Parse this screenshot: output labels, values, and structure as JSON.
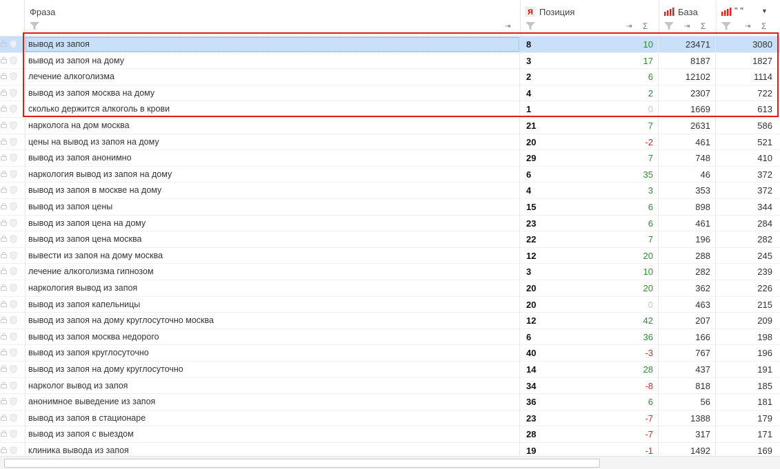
{
  "columns": {
    "phrase": "Фраза",
    "position": "Позиция",
    "base": "База",
    "quote": "\" \""
  },
  "colors": {
    "highlight": "#e31a1a",
    "selected_row": "#c8e0fa",
    "positive": "#2e8b2e",
    "negative": "#d8261e",
    "zero": "#c8c8c8"
  },
  "icons": [
    "lock-icon",
    "shield-icon",
    "filter-icon",
    "pin-icon",
    "sigma-icon",
    "yandex-icon",
    "bar-chart-icon",
    "dropdown-arrow-icon"
  ],
  "rows": [
    {
      "phrase": "вывод из запоя",
      "position": "8",
      "delta": "10",
      "base": "23471",
      "quote": "3080"
    },
    {
      "phrase": "вывод из запоя на дому",
      "position": "3",
      "delta": "17",
      "base": "8187",
      "quote": "1827"
    },
    {
      "phrase": "лечение алкоголизма",
      "position": "2",
      "delta": "6",
      "base": "12102",
      "quote": "1114"
    },
    {
      "phrase": "вывод из запоя москва на дому",
      "position": "4",
      "delta": "2",
      "base": "2307",
      "quote": "722"
    },
    {
      "phrase": "сколько держится алкоголь в крови",
      "position": "1",
      "delta": "0",
      "base": "1669",
      "quote": "613"
    },
    {
      "phrase": "нарколога на дом москва",
      "position": "21",
      "delta": "7",
      "base": "2631",
      "quote": "586"
    },
    {
      "phrase": "цены на вывод из запоя на дому",
      "position": "20",
      "delta": "-2",
      "base": "461",
      "quote": "521"
    },
    {
      "phrase": "вывод из запоя анонимно",
      "position": "29",
      "delta": "7",
      "base": "748",
      "quote": "410"
    },
    {
      "phrase": "наркология вывод из запоя на дому",
      "position": "6",
      "delta": "35",
      "base": "46",
      "quote": "372"
    },
    {
      "phrase": "вывод из запоя в москве на дому",
      "position": "4",
      "delta": "3",
      "base": "353",
      "quote": "372"
    },
    {
      "phrase": "вывод из запоя цены",
      "position": "15",
      "delta": "6",
      "base": "898",
      "quote": "344"
    },
    {
      "phrase": "вывод из запоя цена на дому",
      "position": "23",
      "delta": "6",
      "base": "461",
      "quote": "284"
    },
    {
      "phrase": "вывод из запоя цена москва",
      "position": "22",
      "delta": "7",
      "base": "196",
      "quote": "282"
    },
    {
      "phrase": "вывести из запоя на дому москва",
      "position": "12",
      "delta": "20",
      "base": "288",
      "quote": "245"
    },
    {
      "phrase": "лечение алкоголизма гипнозом",
      "position": "3",
      "delta": "10",
      "base": "282",
      "quote": "239"
    },
    {
      "phrase": "наркология вывод из запоя",
      "position": "20",
      "delta": "20",
      "base": "362",
      "quote": "226"
    },
    {
      "phrase": "вывод из запоя капельницы",
      "position": "20",
      "delta": "0",
      "base": "463",
      "quote": "215"
    },
    {
      "phrase": "вывод из запоя на дому круглосуточно москва",
      "position": "12",
      "delta": "42",
      "base": "207",
      "quote": "209"
    },
    {
      "phrase": "вывод из запоя москва недорого",
      "position": "6",
      "delta": "36",
      "base": "166",
      "quote": "198"
    },
    {
      "phrase": "вывод из запоя круглосуточно",
      "position": "40",
      "delta": "-3",
      "base": "767",
      "quote": "196"
    },
    {
      "phrase": "вывод из запоя на дому круглосуточно",
      "position": "14",
      "delta": "28",
      "base": "437",
      "quote": "191"
    },
    {
      "phrase": "нарколог вывод из запоя",
      "position": "34",
      "delta": "-8",
      "base": "818",
      "quote": "185"
    },
    {
      "phrase": "анонимное выведение из запоя",
      "position": "36",
      "delta": "6",
      "base": "56",
      "quote": "181"
    },
    {
      "phrase": "вывод из запоя в стационаре",
      "position": "23",
      "delta": "-7",
      "base": "1388",
      "quote": "179"
    },
    {
      "phrase": "вывод из запоя с выездом",
      "position": "28",
      "delta": "-7",
      "base": "317",
      "quote": "171"
    },
    {
      "phrase": "клиника вывода из запоя",
      "position": "19",
      "delta": "-1",
      "base": "1492",
      "quote": "169"
    }
  ]
}
